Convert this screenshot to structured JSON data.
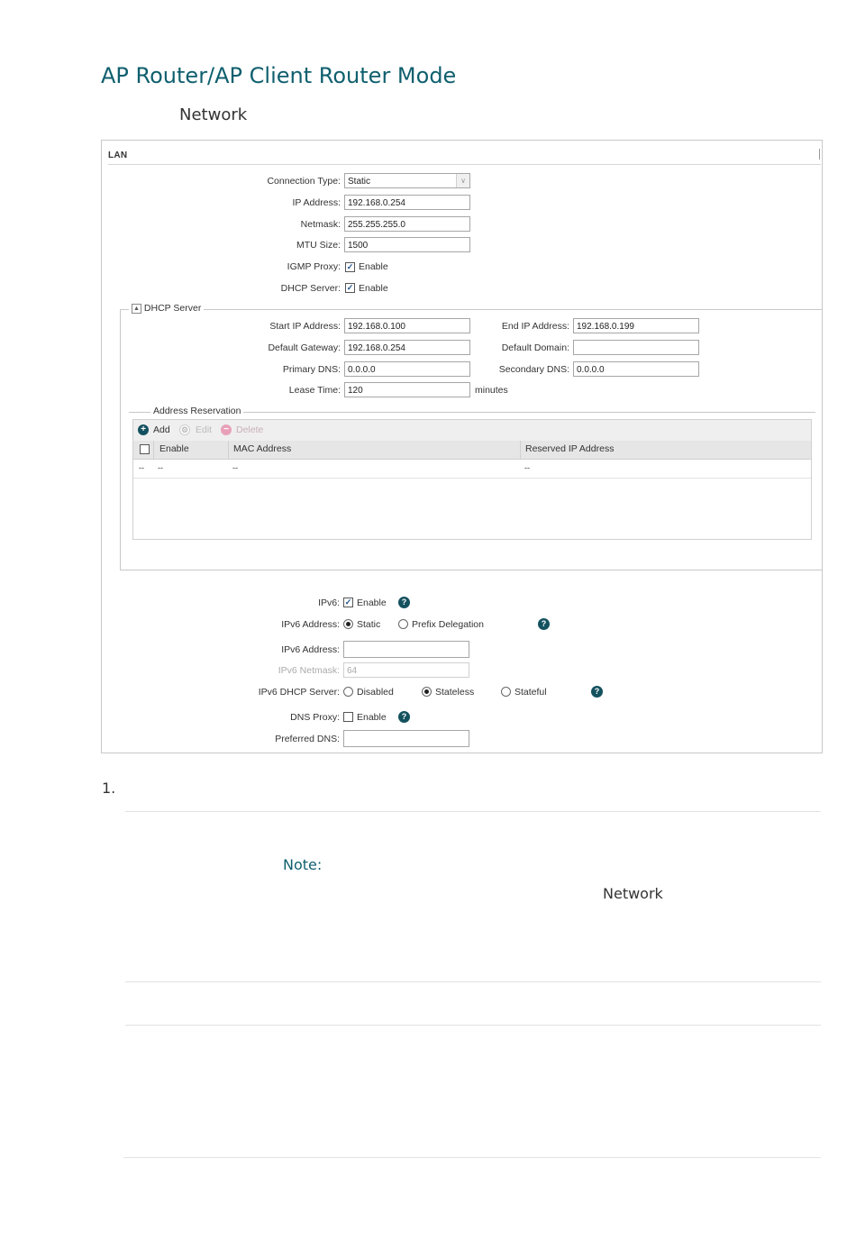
{
  "heading": "AP Router/AP Client Router Mode",
  "subheading": "Network",
  "lan": {
    "title": "LAN",
    "connection_type_label": "Connection Type:",
    "connection_type_value": "Static",
    "ip_address_label": "IP Address:",
    "ip_address_value": "192.168.0.254",
    "netmask_label": "Netmask:",
    "netmask_value": "255.255.255.0",
    "mtu_label": "MTU Size:",
    "mtu_value": "1500",
    "igmp_label": "IGMP Proxy:",
    "igmp_enabled": true,
    "dhcp_label": "DHCP Server:",
    "dhcp_enabled": true,
    "enable_text": "Enable"
  },
  "dhcp": {
    "legend": "DHCP Server",
    "start_ip_label": "Start IP Address:",
    "start_ip_value": "192.168.0.100",
    "end_ip_label": "End IP Address:",
    "end_ip_value": "192.168.0.199",
    "gateway_label": "Default Gateway:",
    "gateway_value": "192.168.0.254",
    "domain_label": "Default Domain:",
    "domain_value": "",
    "primary_dns_label": "Primary DNS:",
    "primary_dns_value": "0.0.0.0",
    "secondary_dns_label": "Secondary DNS:",
    "secondary_dns_value": "0.0.0.0",
    "lease_label": "Lease Time:",
    "lease_value": "120",
    "lease_unit": "minutes"
  },
  "reservation": {
    "legend": "Address Reservation",
    "add_label": "Add",
    "edit_label": "Edit",
    "delete_label": "Delete",
    "columns": [
      "Enable",
      "MAC Address",
      "Reserved IP Address"
    ],
    "row": [
      "--",
      "--",
      "--",
      "--"
    ]
  },
  "ipv6": {
    "ipv6_label": "IPv6:",
    "ipv6_enabled": true,
    "enable_text": "Enable",
    "addr_mode_label": "IPv6 Address:",
    "addr_mode_static": "Static",
    "addr_mode_prefix": "Prefix Delegation",
    "addr_mode_selected": "Static",
    "address_label": "IPv6 Address:",
    "address_value": "",
    "netmask_label": "IPv6 Netmask:",
    "netmask_value": "64",
    "dhcp_label": "IPv6 DHCP Server:",
    "dhcp_disabled": "Disabled",
    "dhcp_stateless": "Stateless",
    "dhcp_stateful": "Stateful",
    "dhcp_selected": "Stateless",
    "dns_proxy_label": "DNS Proxy:",
    "dns_proxy_enabled": false,
    "preferred_dns_label": "Preferred DNS:",
    "preferred_dns_value": "",
    "help_glyph": "?"
  },
  "step_number": "1.",
  "note": {
    "title": "Note:",
    "network_word": "Network"
  },
  "icons": {
    "checkmark": "check-icon",
    "collapse": "collapse-icon",
    "help": "help-icon",
    "add": "add-icon",
    "edit": "gear-icon",
    "delete": "delete-icon",
    "dropdown": "chevron-down-icon"
  },
  "colors": {
    "heading": "#0f5f6e",
    "help_icon": "#14515f",
    "add_icon": "#14515f",
    "delete_icon": "#e8a0b8"
  }
}
